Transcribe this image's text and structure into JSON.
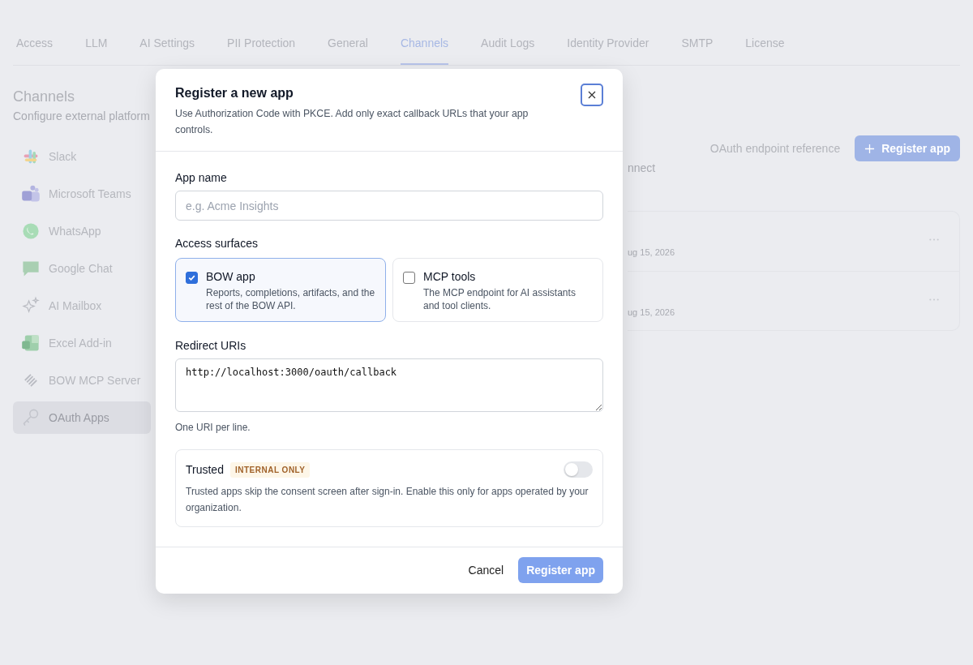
{
  "tabs": [
    {
      "label": "Access",
      "selected": false
    },
    {
      "label": "LLM",
      "selected": false
    },
    {
      "label": "AI Settings",
      "selected": false
    },
    {
      "label": "PII Protection",
      "selected": false
    },
    {
      "label": "General",
      "selected": false
    },
    {
      "label": "Channels",
      "selected": true
    },
    {
      "label": "Audit Logs",
      "selected": false
    },
    {
      "label": "Identity Provider",
      "selected": false
    },
    {
      "label": "SMTP",
      "selected": false
    },
    {
      "label": "License",
      "selected": false
    }
  ],
  "section": {
    "title": "Channels",
    "subtitle": "Configure external platform"
  },
  "sidebar": {
    "items": [
      {
        "label": "Slack",
        "selected": false
      },
      {
        "label": "Microsoft Teams",
        "selected": false
      },
      {
        "label": "WhatsApp",
        "selected": false
      },
      {
        "label": "Google Chat",
        "selected": false
      },
      {
        "label": "AI Mailbox",
        "selected": false
      },
      {
        "label": "Excel Add-in",
        "selected": false
      },
      {
        "label": "BOW MCP Server",
        "selected": false
      },
      {
        "label": "OAuth Apps",
        "selected": true
      }
    ]
  },
  "main": {
    "subtitle_fragment": "nnect",
    "reference_link": "OAuth endpoint reference",
    "register_button": "Register app",
    "apps": [
      {
        "date_fragment": "ug 15, 2026"
      },
      {
        "date_fragment": "ug 15, 2026"
      }
    ]
  },
  "modal": {
    "title": "Register a new app",
    "description": "Use Authorization Code with PKCE. Add only exact callback URLs that your app controls.",
    "app_name": {
      "label": "App name",
      "placeholder": "e.g. Acme Insights"
    },
    "surfaces": {
      "label": "Access surfaces",
      "options": [
        {
          "title": "BOW app",
          "description": "Reports, completions, artifacts, and the rest of the BOW API.",
          "checked": true
        },
        {
          "title": "MCP tools",
          "description": "The MCP endpoint for AI assistants and tool clients.",
          "checked": false
        }
      ]
    },
    "redirect": {
      "label": "Redirect URIs",
      "value": "http://localhost:3000/oauth/callback",
      "hint": "One URI per line."
    },
    "trusted": {
      "label": "Trusted",
      "badge": "INTERNAL ONLY",
      "description": "Trusted apps skip the consent screen after sign-in. Enable this only for apps operated by your organization.",
      "on": false
    },
    "buttons": {
      "cancel": "Cancel",
      "submit": "Register app"
    }
  }
}
